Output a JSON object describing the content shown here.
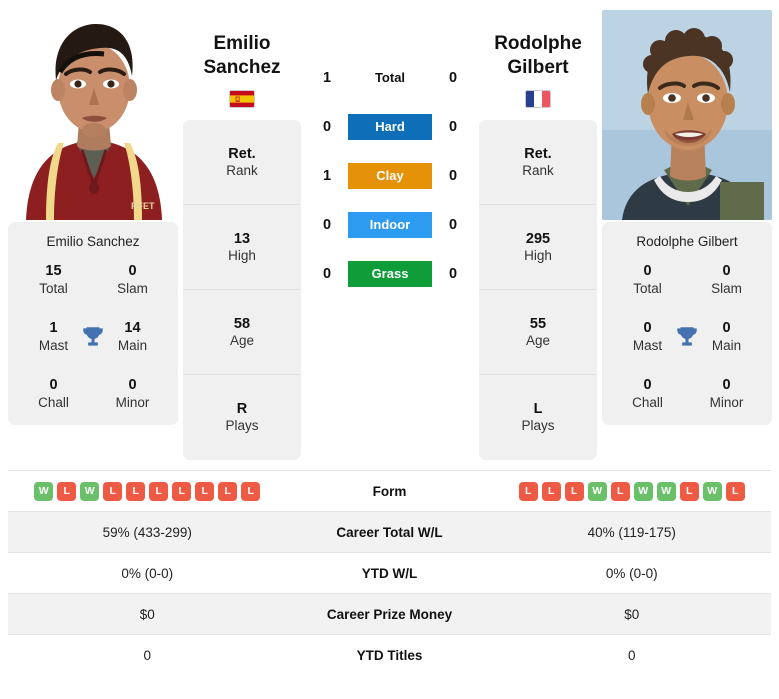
{
  "left_player": {
    "first_name": "Emilio",
    "last_name": "Sanchez",
    "full_name": "Emilio Sanchez",
    "country": "Spain",
    "flag_icon": "spain-flag-icon",
    "photo_alt": "Emilio Sanchez photo",
    "rank": "Ret.",
    "rank_label": "Rank",
    "high": "13",
    "high_label": "High",
    "age": "58",
    "age_label": "Age",
    "plays": "R",
    "plays_label": "Plays",
    "titles": {
      "total": "15",
      "total_label": "Total",
      "slam": "0",
      "slam_label": "Slam",
      "mast": "1",
      "mast_label": "Mast",
      "main": "14",
      "main_label": "Main",
      "chall": "0",
      "chall_label": "Chall",
      "minor": "0",
      "minor_label": "Minor"
    },
    "h2h": {
      "total": "1",
      "hard": "0",
      "clay": "1",
      "indoor": "0",
      "grass": "0"
    },
    "form": [
      "W",
      "L",
      "W",
      "L",
      "L",
      "L",
      "L",
      "L",
      "L",
      "L"
    ],
    "career_total_wl": "59% (433-299)",
    "ytd_wl": "0% (0-0)",
    "career_prize_money": "$0",
    "ytd_titles": "0"
  },
  "right_player": {
    "first_name": "Rodolphe",
    "last_name": "Gilbert",
    "full_name": "Rodolphe Gilbert",
    "country": "France",
    "flag_icon": "france-flag-icon",
    "photo_alt": "Rodolphe Gilbert photo",
    "rank": "Ret.",
    "rank_label": "Rank",
    "high": "295",
    "high_label": "High",
    "age": "55",
    "age_label": "Age",
    "plays": "L",
    "plays_label": "Plays",
    "titles": {
      "total": "0",
      "total_label": "Total",
      "slam": "0",
      "slam_label": "Slam",
      "mast": "0",
      "mast_label": "Mast",
      "main": "0",
      "main_label": "Main",
      "chall": "0",
      "chall_label": "Chall",
      "minor": "0",
      "minor_label": "Minor"
    },
    "h2h": {
      "total": "0",
      "hard": "0",
      "clay": "0",
      "indoor": "0",
      "grass": "0"
    },
    "form": [
      "L",
      "L",
      "L",
      "W",
      "L",
      "W",
      "W",
      "L",
      "W",
      "L"
    ],
    "career_total_wl": "40% (119-175)",
    "ytd_wl": "0% (0-0)",
    "career_prize_money": "$0",
    "ytd_titles": "0"
  },
  "surfaces": {
    "total_label": "Total",
    "hard_label": "Hard",
    "clay_label": "Clay",
    "indoor_label": "Indoor",
    "grass_label": "Grass"
  },
  "table_labels": {
    "form": "Form",
    "career_total_wl": "Career Total W/L",
    "ytd_wl": "YTD W/L",
    "career_prize_money": "Career Prize Money",
    "ytd_titles": "YTD Titles"
  },
  "colors": {
    "hard": "#0e6eb8",
    "clay": "#e69208",
    "indoor": "#2d9bf0",
    "grass": "#0f9d3a",
    "win": "#6abf69",
    "loss": "#ef5a44",
    "trophy": "#4472b0",
    "card_bg": "#f0f0f0",
    "row_shade": "#f2f2f2"
  }
}
